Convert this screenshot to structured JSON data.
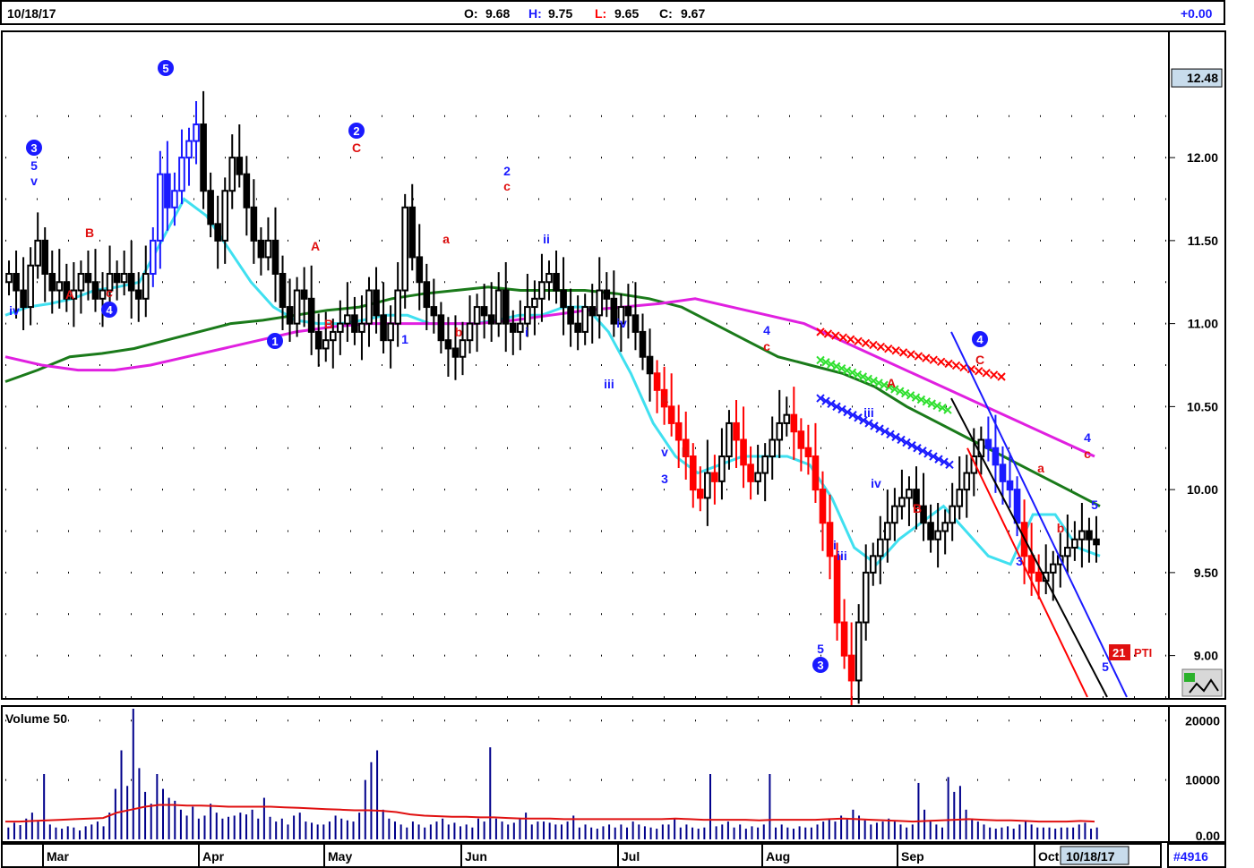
{
  "header": {
    "date": "10/18/17",
    "o_label": "O:",
    "o_value": "9.68",
    "h_label": "H:",
    "h_value": "9.75",
    "l_label": "L:",
    "l_value": "9.65",
    "c_label": "C:",
    "c_value": "9.67",
    "change": "+0.00"
  },
  "colors": {
    "up_blue": "#1a1aff",
    "down_red": "#ff0000",
    "ma_cyan": "#40e0f0",
    "ma_green": "#1a7a1a",
    "ma_magenta": "#e020e0",
    "volume_bar": "#00008b",
    "volume_ma": "#e01010",
    "wave_blue": "#1a1aff",
    "wave_red": "#e01010"
  },
  "footer": {
    "date_badge": "10/18/17",
    "symbol_badge": "#4916"
  },
  "pti": {
    "value": "21",
    "label": "PTI"
  },
  "chart_data": [
    {
      "type": "candlestick",
      "title": "",
      "price_marker": "12.48",
      "yticks": [
        "12.00",
        "11.50",
        "11.00",
        "10.50",
        "10.00",
        "9.50",
        "9.00"
      ],
      "ylim": [
        8.75,
        12.75
      ],
      "xticks": [
        "Mar",
        "Apr",
        "May",
        "Jun",
        "Jul",
        "Aug",
        "Sep",
        "Oct"
      ],
      "grid": true,
      "closes": [
        11.3,
        11.2,
        11.1,
        11.35,
        11.5,
        11.3,
        11.2,
        11.25,
        11.15,
        11.2,
        11.3,
        11.25,
        11.15,
        11.2,
        11.3,
        11.25,
        11.3,
        11.2,
        11.15,
        11.3,
        11.5,
        11.9,
        11.7,
        11.8,
        12.0,
        12.1,
        12.2,
        11.8,
        11.6,
        11.5,
        11.8,
        12.0,
        11.9,
        11.7,
        11.5,
        11.4,
        11.5,
        11.3,
        11.1,
        11.0,
        11.2,
        11.15,
        10.95,
        10.85,
        10.9,
        10.95,
        11.0,
        11.05,
        10.95,
        11.0,
        11.2,
        11.05,
        10.9,
        11.0,
        11.2,
        11.7,
        11.4,
        11.25,
        11.1,
        11.05,
        10.9,
        10.85,
        10.8,
        10.9,
        11.0,
        11.1,
        11.05,
        11.0,
        11.2,
        11.0,
        10.95,
        11.0,
        11.1,
        11.15,
        11.25,
        11.3,
        11.2,
        11.1,
        11.0,
        10.95,
        11.1,
        11.05,
        11.2,
        11.15,
        11.0,
        11.1,
        11.05,
        10.95,
        10.8,
        10.7,
        10.6,
        10.5,
        10.4,
        10.3,
        10.2,
        10.0,
        9.95,
        10.1,
        10.05,
        10.2,
        10.4,
        10.3,
        10.15,
        10.05,
        10.1,
        10.2,
        10.3,
        10.4,
        10.45,
        10.35,
        10.25,
        10.2,
        10.0,
        9.8,
        9.6,
        9.2,
        9.0,
        8.85,
        9.2,
        9.5,
        9.6,
        9.7,
        9.8,
        9.9,
        9.95,
        10.0,
        9.9,
        9.8,
        9.7,
        9.75,
        9.8,
        9.9,
        10.0,
        10.1,
        10.2,
        10.3,
        10.25,
        10.15,
        10.05,
        10.0,
        9.8,
        9.6,
        9.5,
        9.45,
        9.5,
        9.55,
        9.6,
        9.65,
        9.7,
        9.75,
        9.7,
        9.67
      ],
      "moving_averages": [
        {
          "name": "",
          "color": "#40e0f0",
          "values": [
            11.05,
            11.1,
            11.12,
            11.15,
            11.2,
            11.22,
            11.25,
            11.5,
            11.75,
            11.65,
            11.45,
            11.25,
            11.1,
            11.02,
            11.0,
            11.0,
            11.02,
            11.05,
            11.05,
            11.0,
            11.0,
            11.0,
            11.02,
            11.05,
            11.05,
            11.1,
            11.1,
            10.95,
            10.7,
            10.4,
            10.2,
            10.1,
            10.15,
            10.2,
            10.2,
            10.2,
            10.15,
            9.95,
            9.65,
            9.55,
            9.7,
            9.8,
            9.9,
            9.75,
            9.6,
            9.55,
            9.85,
            9.85,
            9.65,
            9.6
          ]
        },
        {
          "name": "",
          "color": "#1a7a1a",
          "values": [
            10.65,
            10.72,
            10.8,
            10.82,
            10.85,
            10.9,
            10.95,
            11.0,
            11.02,
            11.05,
            11.08,
            11.1,
            11.15,
            11.18,
            11.2,
            11.22,
            11.2,
            11.2,
            11.2,
            11.18,
            11.15,
            11.1,
            11.0,
            10.9,
            10.8,
            10.75,
            10.7,
            10.62,
            10.5,
            10.4,
            10.3,
            10.2,
            10.1,
            10.0,
            9.9
          ]
        },
        {
          "name": "",
          "color": "#e020e0",
          "values": [
            10.8,
            10.75,
            10.72,
            10.72,
            10.75,
            10.8,
            10.85,
            10.9,
            10.95,
            10.98,
            11.0,
            11.0,
            11.0,
            11.0,
            11.02,
            11.05,
            11.08,
            11.1,
            11.12,
            11.15,
            11.1,
            11.05,
            11.0,
            10.9,
            10.8,
            10.7,
            10.6,
            10.5,
            10.4,
            10.3,
            10.2
          ]
        }
      ],
      "wave_labels": [
        {
          "text": "iv",
          "color": "blue"
        },
        {
          "text": "3",
          "color": "blue",
          "circled": true
        },
        {
          "text": "5",
          "color": "blue"
        },
        {
          "text": "v",
          "color": "blue"
        },
        {
          "text": "A",
          "color": "red"
        },
        {
          "text": "B",
          "color": "red"
        },
        {
          "text": "c",
          "color": "red"
        },
        {
          "text": "4",
          "color": "blue",
          "circled": true
        },
        {
          "text": "5",
          "color": "blue",
          "circled": true
        },
        {
          "text": "1",
          "color": "blue",
          "circled": true
        },
        {
          "text": "2",
          "color": "blue",
          "circled": true
        },
        {
          "text": "C",
          "color": "red"
        },
        {
          "text": "A",
          "color": "red"
        },
        {
          "text": "B",
          "color": "red"
        },
        {
          "text": "1",
          "color": "blue"
        },
        {
          "text": "a",
          "color": "red"
        },
        {
          "text": "b",
          "color": "red"
        },
        {
          "text": "2",
          "color": "blue"
        },
        {
          "text": "c",
          "color": "red"
        },
        {
          "text": "ii",
          "color": "blue"
        },
        {
          "text": "i",
          "color": "blue"
        },
        {
          "text": "iv",
          "color": "blue"
        },
        {
          "text": "iii",
          "color": "blue"
        },
        {
          "text": "a",
          "color": "red"
        },
        {
          "text": "v",
          "color": "blue"
        },
        {
          "text": "b",
          "color": "red"
        },
        {
          "text": "3",
          "color": "blue"
        },
        {
          "text": "4",
          "color": "blue"
        },
        {
          "text": "c",
          "color": "red"
        },
        {
          "text": "5",
          "color": "blue"
        },
        {
          "text": "3",
          "color": "blue",
          "circled": true
        },
        {
          "text": "i",
          "color": "blue"
        },
        {
          "text": "iii",
          "color": "blue"
        },
        {
          "text": "iii",
          "color": "blue"
        },
        {
          "text": "iv",
          "color": "blue"
        },
        {
          "text": "A",
          "color": "red"
        },
        {
          "text": "B",
          "color": "red"
        },
        {
          "text": "4",
          "color": "blue",
          "circled": true
        },
        {
          "text": "C",
          "color": "red"
        },
        {
          "text": "a",
          "color": "red"
        },
        {
          "text": "3",
          "color": "blue"
        },
        {
          "text": "b",
          "color": "red"
        },
        {
          "text": "4",
          "color": "blue"
        },
        {
          "text": "c",
          "color": "red"
        },
        {
          "text": "5",
          "color": "blue"
        },
        {
          "text": "5",
          "color": "blue"
        }
      ]
    },
    {
      "type": "bar",
      "title": "Volume 50",
      "yticks": [
        "20000",
        "10000",
        "0.00"
      ],
      "ylim": [
        0,
        22000
      ],
      "values": [
        2000,
        2800,
        2400,
        3500,
        4500,
        3000,
        11000,
        2500,
        2000,
        1800,
        2200,
        2000,
        1500,
        2200,
        2500,
        3000,
        2200,
        4500,
        8500,
        15000,
        9000,
        23000,
        12000,
        8000,
        6000,
        11000,
        8500,
        7000,
        6500,
        5000,
        4000,
        5500,
        3500,
        4000,
        6000,
        4500,
        3500,
        3800,
        4000,
        4500,
        4200,
        5000,
        3500,
        7000,
        3800,
        3000,
        3500,
        2500,
        4000,
        4500,
        3000,
        2800,
        2500,
        2500,
        3000,
        4000,
        3500,
        3200,
        3000,
        4500,
        10000,
        13000,
        15000,
        5000,
        3500,
        3000,
        2500,
        2000,
        3000,
        2500,
        2000,
        2500,
        3000,
        3500,
        2500,
        2800,
        2200,
        2500,
        2000,
        3500,
        3000,
        15500,
        3500,
        3000,
        2500,
        2800,
        3500,
        4500,
        2500,
        3000,
        3000,
        2800,
        2500,
        2500,
        3000,
        4000,
        2000,
        2500,
        2000,
        1800,
        2200,
        2500,
        2000,
        2500,
        2000,
        3000,
        2500,
        2200,
        2000,
        1800,
        2500,
        2500,
        3500,
        2000,
        2500,
        2000,
        1800,
        2000,
        11000,
        2200,
        2500,
        3000,
        2000,
        2500,
        1800,
        2200,
        2000,
        2500,
        11000,
        2000,
        2500,
        2000,
        1800,
        2200,
        2000,
        2000,
        2500,
        3000,
        3500,
        3000,
        4000,
        3500,
        5000,
        4000,
        3200,
        2500,
        2800,
        3000,
        3500,
        3000,
        2500,
        2000,
        2500,
        9500,
        5000,
        3000,
        2500,
        2000,
        10500,
        8000,
        9000,
        5000,
        3500,
        3000,
        2500,
        2000,
        1800,
        2000,
        2200,
        1800,
        2500,
        3000,
        2500,
        2000,
        2000,
        2000,
        1800,
        2000,
        2000,
        2000,
        2500,
        2800,
        1800,
        2000
      ],
      "ma_values": [
        3000,
        3000,
        3100,
        3200,
        3300,
        3400,
        3500,
        3600,
        4500,
        5000,
        5500,
        5800,
        5800,
        5700,
        5700,
        5600,
        5500,
        5500,
        5500,
        5500,
        5400,
        5300,
        5200,
        5100,
        5000,
        4900,
        4900,
        4800,
        4600,
        4200,
        4000,
        3900,
        3800,
        3800,
        3700,
        3700,
        3600,
        3500,
        3500,
        3500,
        3400,
        3400,
        3400,
        3400,
        3400,
        3400,
        3400,
        3400,
        3500,
        3400,
        3300,
        3300,
        3300,
        3300,
        3200,
        3300,
        3300,
        3300,
        3300,
        3400,
        3500,
        3400,
        3300,
        3200,
        3100,
        3000,
        3100,
        3200,
        3300,
        3400,
        3300,
        3200,
        3200,
        3100,
        3000,
        3000,
        3000,
        3100,
        3000
      ]
    }
  ]
}
